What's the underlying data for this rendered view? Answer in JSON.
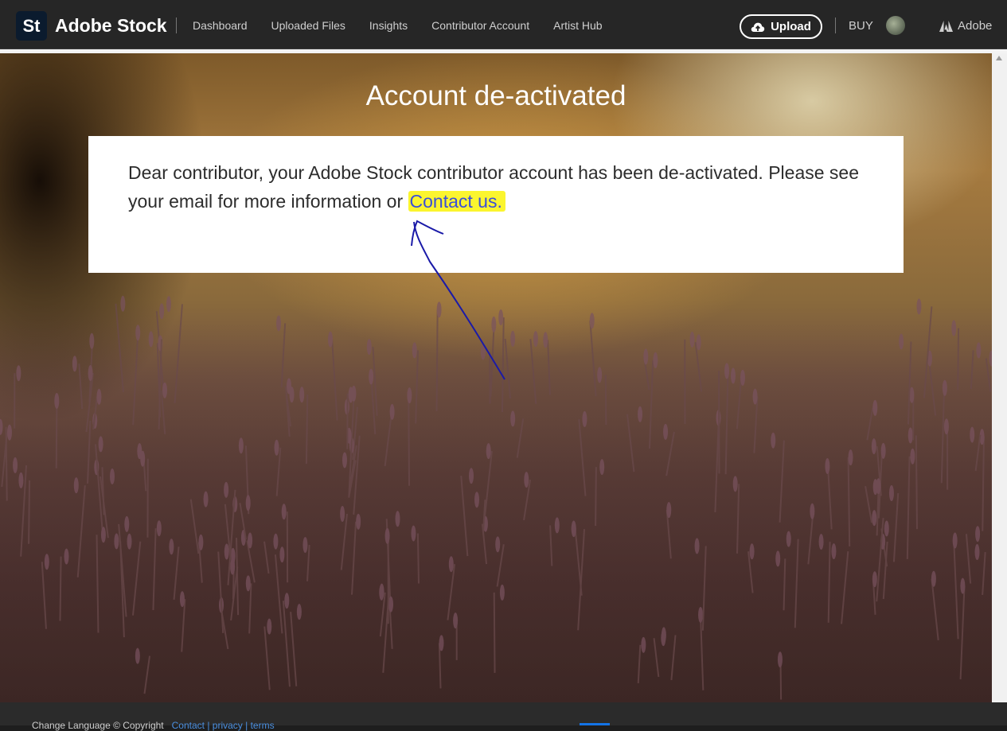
{
  "header": {
    "logo_text": "St",
    "brand": "Adobe Stock",
    "nav": [
      "Dashboard",
      "Uploaded Files",
      "Insights",
      "Contributor Account",
      "Artist Hub"
    ],
    "upload_label": "Upload",
    "buy_label": "BUY",
    "adobe_label": "Adobe"
  },
  "main": {
    "title": "Account de-activated",
    "message": "Dear contributor, your Adobe Stock contributor account has been de-activated. Please see your email for more information or ",
    "contact_link": "Contact us."
  },
  "footer": {
    "text": "Change    Language  © Copyright",
    "link": "Contact  |  privacy  |  terms"
  },
  "colors": {
    "highlight": "#fbf52e",
    "annotation_arrow": "#1a1aa8",
    "header_bg": "#262626"
  }
}
